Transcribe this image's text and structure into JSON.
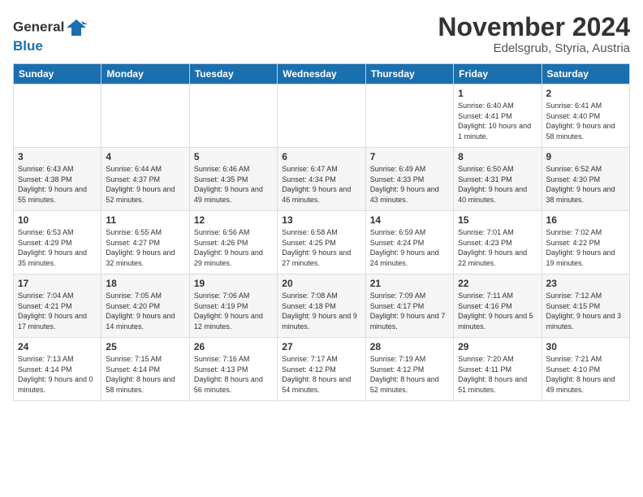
{
  "logo": {
    "text_general": "General",
    "text_blue": "Blue"
  },
  "title": "November 2024",
  "location": "Edelsgrub, Styria, Austria",
  "days_of_week": [
    "Sunday",
    "Monday",
    "Tuesday",
    "Wednesday",
    "Thursday",
    "Friday",
    "Saturday"
  ],
  "weeks": [
    [
      {
        "day": "",
        "info": ""
      },
      {
        "day": "",
        "info": ""
      },
      {
        "day": "",
        "info": ""
      },
      {
        "day": "",
        "info": ""
      },
      {
        "day": "",
        "info": ""
      },
      {
        "day": "1",
        "info": "Sunrise: 6:40 AM\nSunset: 4:41 PM\nDaylight: 10 hours and 1 minute."
      },
      {
        "day": "2",
        "info": "Sunrise: 6:41 AM\nSunset: 4:40 PM\nDaylight: 9 hours and 58 minutes."
      }
    ],
    [
      {
        "day": "3",
        "info": "Sunrise: 6:43 AM\nSunset: 4:38 PM\nDaylight: 9 hours and 55 minutes."
      },
      {
        "day": "4",
        "info": "Sunrise: 6:44 AM\nSunset: 4:37 PM\nDaylight: 9 hours and 52 minutes."
      },
      {
        "day": "5",
        "info": "Sunrise: 6:46 AM\nSunset: 4:35 PM\nDaylight: 9 hours and 49 minutes."
      },
      {
        "day": "6",
        "info": "Sunrise: 6:47 AM\nSunset: 4:34 PM\nDaylight: 9 hours and 46 minutes."
      },
      {
        "day": "7",
        "info": "Sunrise: 6:49 AM\nSunset: 4:33 PM\nDaylight: 9 hours and 43 minutes."
      },
      {
        "day": "8",
        "info": "Sunrise: 6:50 AM\nSunset: 4:31 PM\nDaylight: 9 hours and 40 minutes."
      },
      {
        "day": "9",
        "info": "Sunrise: 6:52 AM\nSunset: 4:30 PM\nDaylight: 9 hours and 38 minutes."
      }
    ],
    [
      {
        "day": "10",
        "info": "Sunrise: 6:53 AM\nSunset: 4:29 PM\nDaylight: 9 hours and 35 minutes."
      },
      {
        "day": "11",
        "info": "Sunrise: 6:55 AM\nSunset: 4:27 PM\nDaylight: 9 hours and 32 minutes."
      },
      {
        "day": "12",
        "info": "Sunrise: 6:56 AM\nSunset: 4:26 PM\nDaylight: 9 hours and 29 minutes."
      },
      {
        "day": "13",
        "info": "Sunrise: 6:58 AM\nSunset: 4:25 PM\nDaylight: 9 hours and 27 minutes."
      },
      {
        "day": "14",
        "info": "Sunrise: 6:59 AM\nSunset: 4:24 PM\nDaylight: 9 hours and 24 minutes."
      },
      {
        "day": "15",
        "info": "Sunrise: 7:01 AM\nSunset: 4:23 PM\nDaylight: 9 hours and 22 minutes."
      },
      {
        "day": "16",
        "info": "Sunrise: 7:02 AM\nSunset: 4:22 PM\nDaylight: 9 hours and 19 minutes."
      }
    ],
    [
      {
        "day": "17",
        "info": "Sunrise: 7:04 AM\nSunset: 4:21 PM\nDaylight: 9 hours and 17 minutes."
      },
      {
        "day": "18",
        "info": "Sunrise: 7:05 AM\nSunset: 4:20 PM\nDaylight: 9 hours and 14 minutes."
      },
      {
        "day": "19",
        "info": "Sunrise: 7:06 AM\nSunset: 4:19 PM\nDaylight: 9 hours and 12 minutes."
      },
      {
        "day": "20",
        "info": "Sunrise: 7:08 AM\nSunset: 4:18 PM\nDaylight: 9 hours and 9 minutes."
      },
      {
        "day": "21",
        "info": "Sunrise: 7:09 AM\nSunset: 4:17 PM\nDaylight: 9 hours and 7 minutes."
      },
      {
        "day": "22",
        "info": "Sunrise: 7:11 AM\nSunset: 4:16 PM\nDaylight: 9 hours and 5 minutes."
      },
      {
        "day": "23",
        "info": "Sunrise: 7:12 AM\nSunset: 4:15 PM\nDaylight: 9 hours and 3 minutes."
      }
    ],
    [
      {
        "day": "24",
        "info": "Sunrise: 7:13 AM\nSunset: 4:14 PM\nDaylight: 9 hours and 0 minutes."
      },
      {
        "day": "25",
        "info": "Sunrise: 7:15 AM\nSunset: 4:14 PM\nDaylight: 8 hours and 58 minutes."
      },
      {
        "day": "26",
        "info": "Sunrise: 7:16 AM\nSunset: 4:13 PM\nDaylight: 8 hours and 56 minutes."
      },
      {
        "day": "27",
        "info": "Sunrise: 7:17 AM\nSunset: 4:12 PM\nDaylight: 8 hours and 54 minutes."
      },
      {
        "day": "28",
        "info": "Sunrise: 7:19 AM\nSunset: 4:12 PM\nDaylight: 8 hours and 52 minutes."
      },
      {
        "day": "29",
        "info": "Sunrise: 7:20 AM\nSunset: 4:11 PM\nDaylight: 8 hours and 51 minutes."
      },
      {
        "day": "30",
        "info": "Sunrise: 7:21 AM\nSunset: 4:10 PM\nDaylight: 8 hours and 49 minutes."
      }
    ]
  ]
}
